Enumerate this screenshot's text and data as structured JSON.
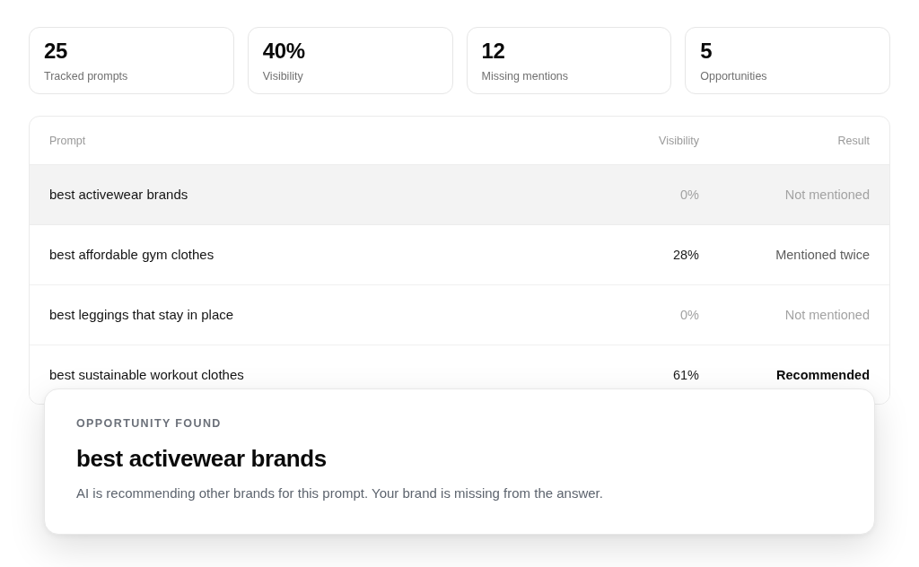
{
  "stats": [
    {
      "value": "25",
      "label": "Tracked prompts"
    },
    {
      "value": "40%",
      "label": "Visibility"
    },
    {
      "value": "12",
      "label": "Missing mentions"
    },
    {
      "value": "5",
      "label": "Opportunities"
    }
  ],
  "table": {
    "columns": [
      "Prompt",
      "Visibility",
      "Result"
    ],
    "rows": [
      {
        "prompt": "best activewear brands",
        "visibility": "0%",
        "result": "Not mentioned",
        "kind": "missing",
        "selected": true
      },
      {
        "prompt": "best affordable gym clothes",
        "visibility": "28%",
        "result": "Mentioned twice",
        "kind": "mentioned",
        "selected": false
      },
      {
        "prompt": "best leggings that stay in place",
        "visibility": "0%",
        "result": "Not mentioned",
        "kind": "missing",
        "selected": false
      },
      {
        "prompt": "best sustainable workout clothes",
        "visibility": "61%",
        "result": "Recommended",
        "kind": "recommended",
        "selected": false
      }
    ]
  },
  "callout": {
    "label": "OPPORTUNITY FOUND",
    "title": "best activewear brands",
    "text": "AI is recommending other brands for this prompt. Your brand is missing from the answer."
  }
}
